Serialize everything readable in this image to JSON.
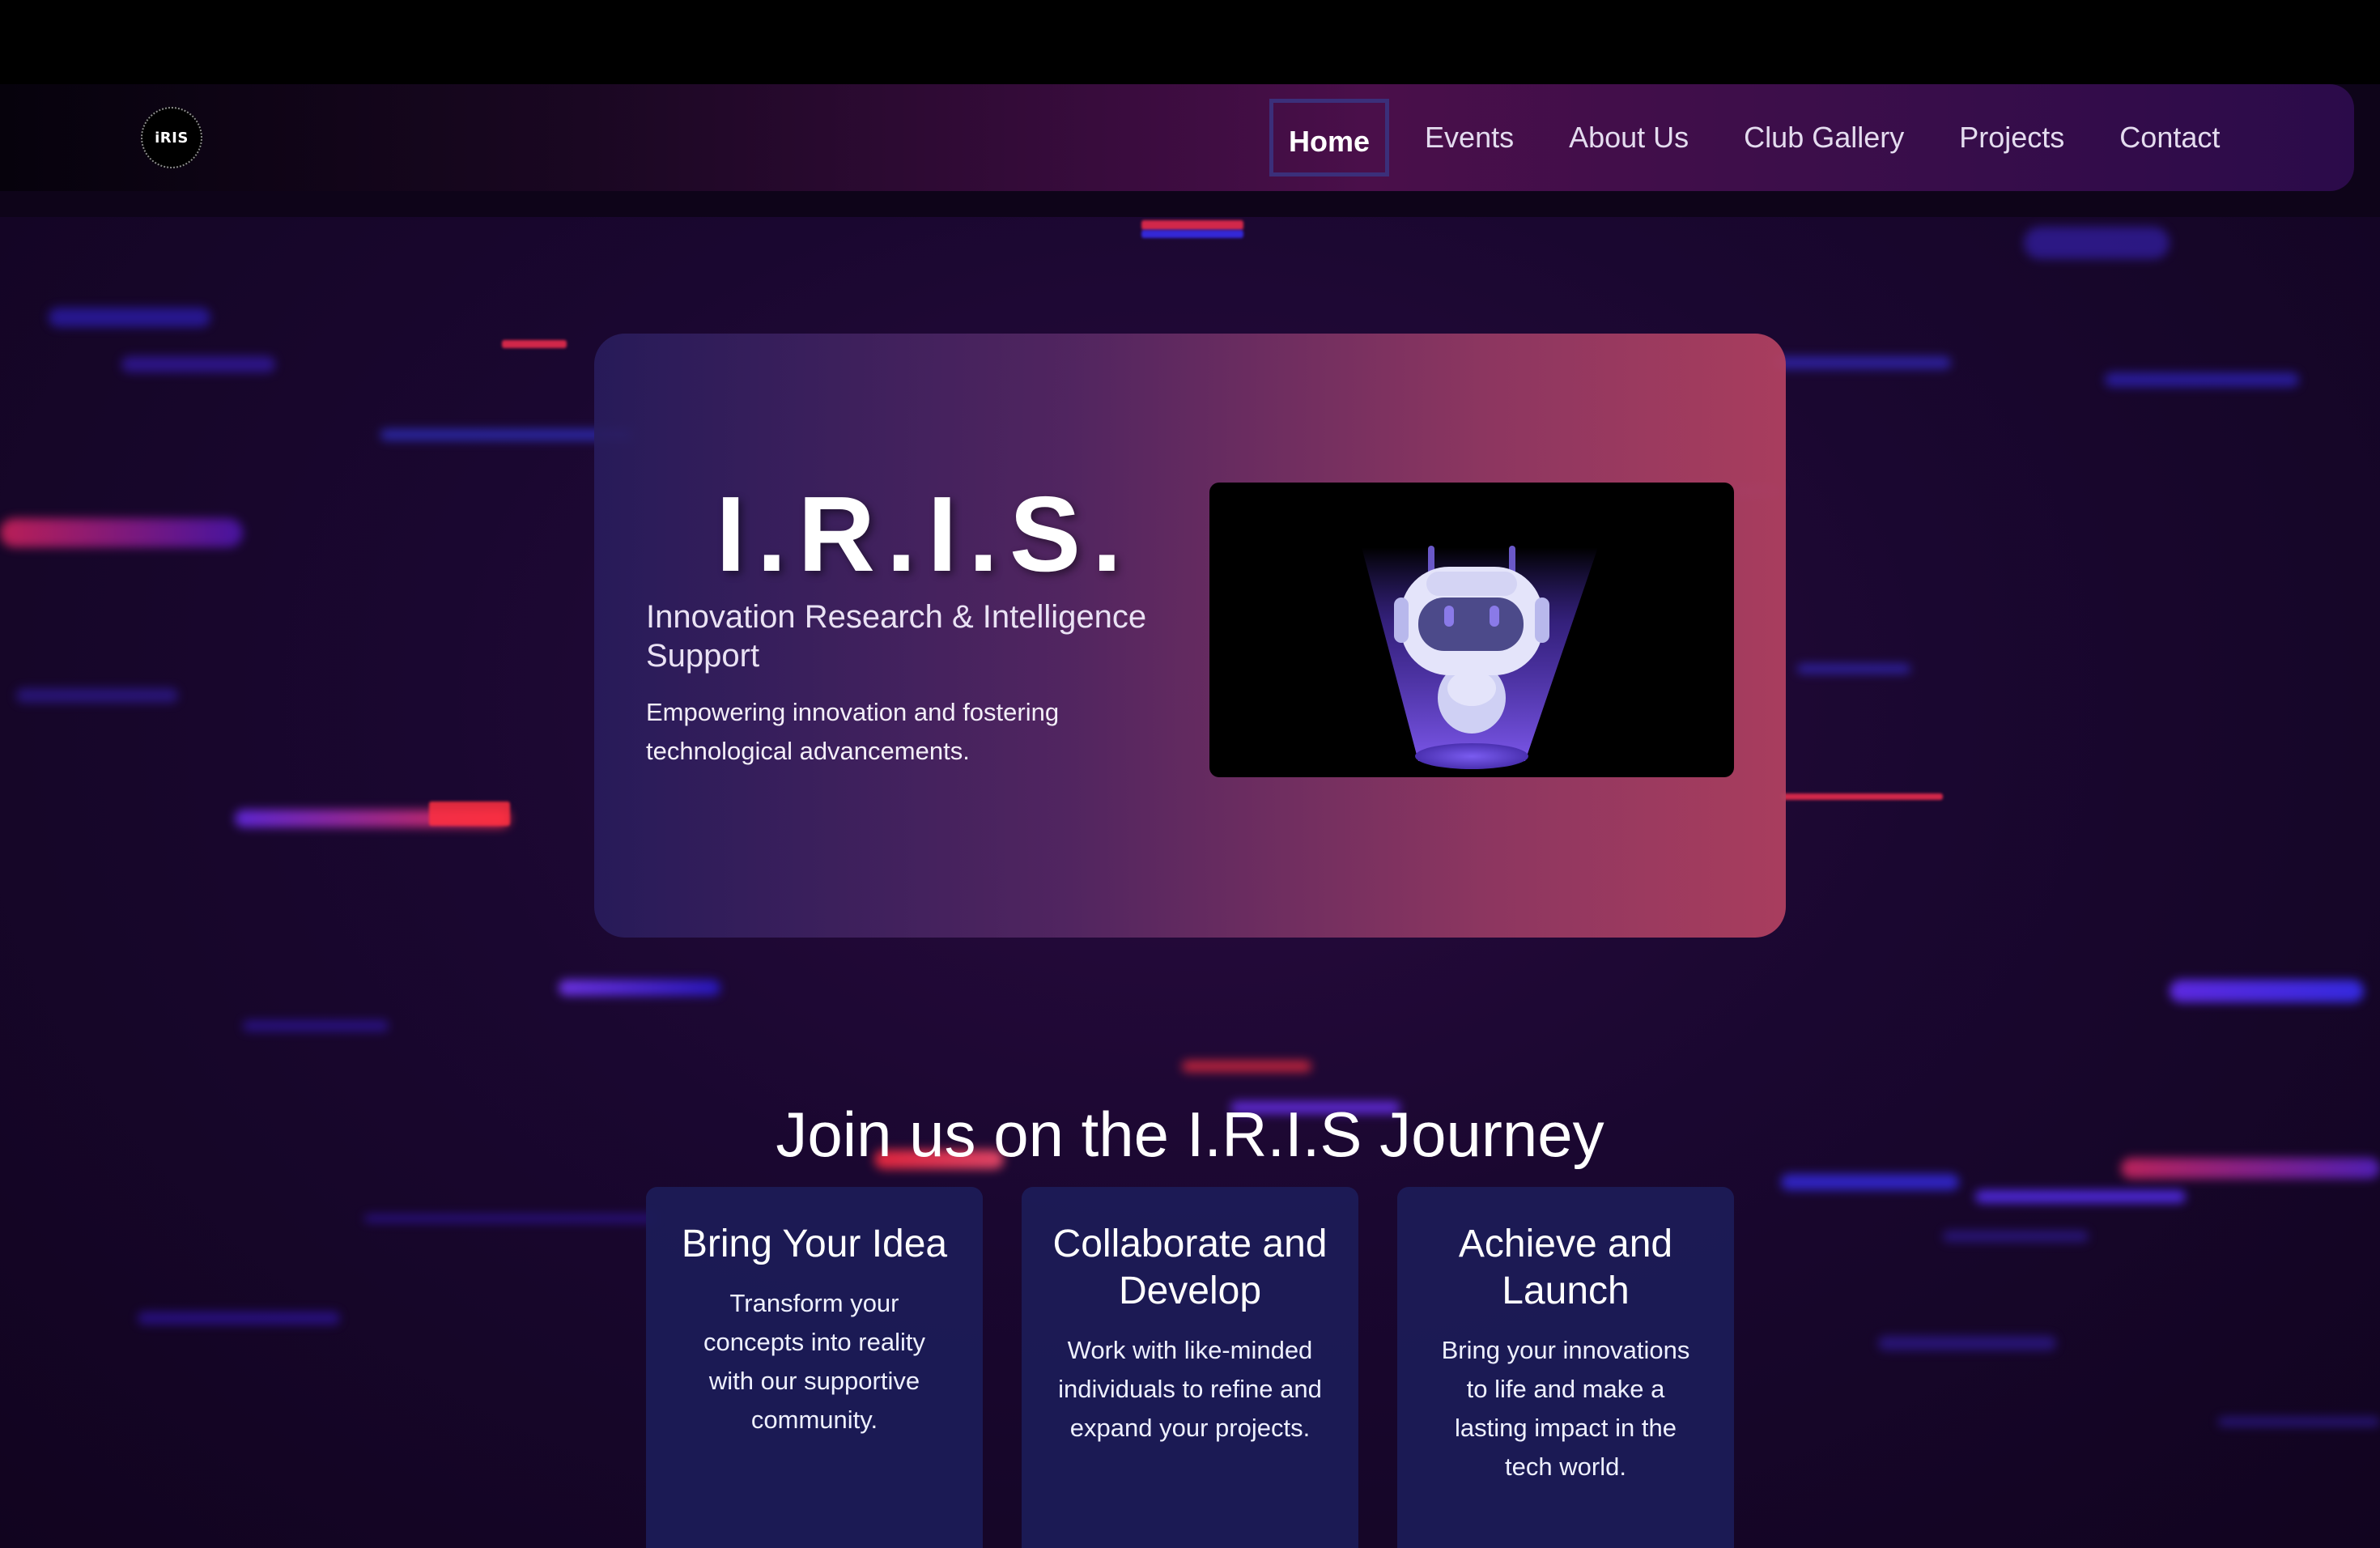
{
  "navbar": {
    "logo_text": "iRIS",
    "items": [
      {
        "label": "Home",
        "active": true
      },
      {
        "label": "Events",
        "active": false
      },
      {
        "label": "About Us",
        "active": false
      },
      {
        "label": "Club Gallery",
        "active": false
      },
      {
        "label": "Projects",
        "active": false
      },
      {
        "label": "Contact",
        "active": false
      }
    ]
  },
  "hero": {
    "title": "I.R.I.S.",
    "subtitle": "Innovation Research & Intelligence Support",
    "description": "Empowering innovation and fostering technological advancements.",
    "image_icon": "robot-icon"
  },
  "journey": {
    "title": "Join us on the I.R.I.S Journey",
    "cards": [
      {
        "title": "Bring Your Idea",
        "text": "Transform your concepts into reality with our supportive community."
      },
      {
        "title": "Collaborate and Develop",
        "text": "Work with like-minded individuals to refine and expand your projects."
      },
      {
        "title": "Achieve and Launch",
        "text": "Bring your innovations to life and make a lasting impact in the tech world."
      }
    ]
  },
  "colors": {
    "background": "#1a0730",
    "nav_active_border": "#3b2f7a",
    "card_bg": "#1c1c58",
    "hero_gradient_start": "#281c5c",
    "hero_gradient_end": "#b04060"
  }
}
